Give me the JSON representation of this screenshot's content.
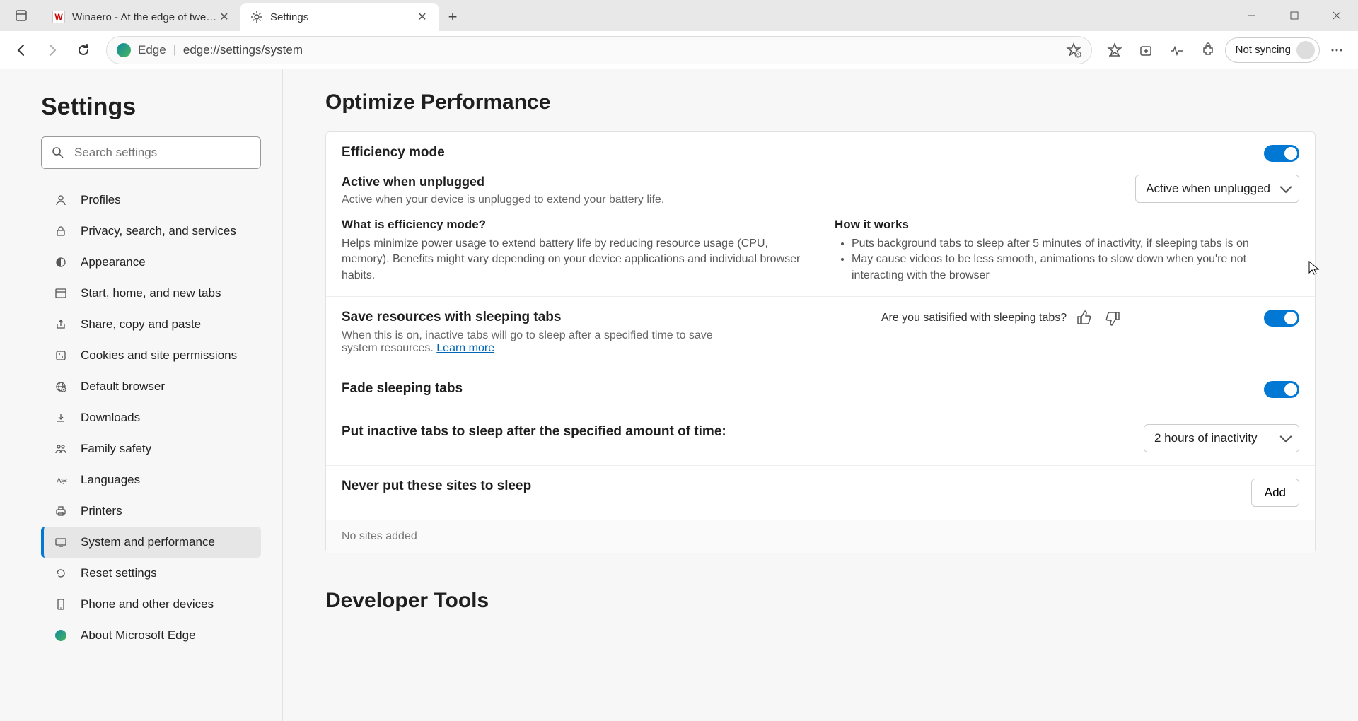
{
  "titlebar": {
    "tabs": [
      {
        "title": "Winaero - At the edge of tweaking",
        "favicon": "W"
      },
      {
        "title": "Settings",
        "favicon": "gear"
      }
    ]
  },
  "toolbar": {
    "address_label": "Edge",
    "url": "edge://settings/system",
    "profile_label": "Not syncing"
  },
  "sidebar": {
    "title": "Settings",
    "search_placeholder": "Search settings",
    "items": [
      {
        "label": "Profiles"
      },
      {
        "label": "Privacy, search, and services"
      },
      {
        "label": "Appearance"
      },
      {
        "label": "Start, home, and new tabs"
      },
      {
        "label": "Share, copy and paste"
      },
      {
        "label": "Cookies and site permissions"
      },
      {
        "label": "Default browser"
      },
      {
        "label": "Downloads"
      },
      {
        "label": "Family safety"
      },
      {
        "label": "Languages"
      },
      {
        "label": "Printers"
      },
      {
        "label": "System and performance"
      },
      {
        "label": "Reset settings"
      },
      {
        "label": "Phone and other devices"
      },
      {
        "label": "About Microsoft Edge"
      }
    ]
  },
  "content": {
    "heading1": "Optimize Performance",
    "efficiency": {
      "title": "Efficiency mode",
      "sub_title": "Active when unplugged",
      "sub_desc": "Active when your device is unplugged to extend your battery life.",
      "dropdown": "Active when unplugged",
      "what_h": "What is efficiency mode?",
      "what_p": "Helps minimize power usage to extend battery life by reducing resource usage (CPU, memory). Benefits might vary depending on your device applications and individual browser habits.",
      "how_h": "How it works",
      "how_li1": "Puts background tabs to sleep after 5 minutes of inactivity, if sleeping tabs is on",
      "how_li2": "May cause videos to be less smooth, animations to slow down when you're not interacting with the browser"
    },
    "sleeping": {
      "title": "Save resources with sleeping tabs",
      "desc": "When this is on, inactive tabs will go to sleep after a specified time to save system resources. ",
      "learn": "Learn more",
      "feedback_q": "Are you satisified with sleeping tabs?"
    },
    "fade": {
      "title": "Fade sleeping tabs"
    },
    "inactive": {
      "title": "Put inactive tabs to sleep after the specified amount of time:",
      "dropdown": "2 hours of inactivity"
    },
    "never": {
      "title": "Never put these sites to sleep",
      "add": "Add",
      "empty": "No sites added"
    },
    "heading2": "Developer Tools"
  }
}
